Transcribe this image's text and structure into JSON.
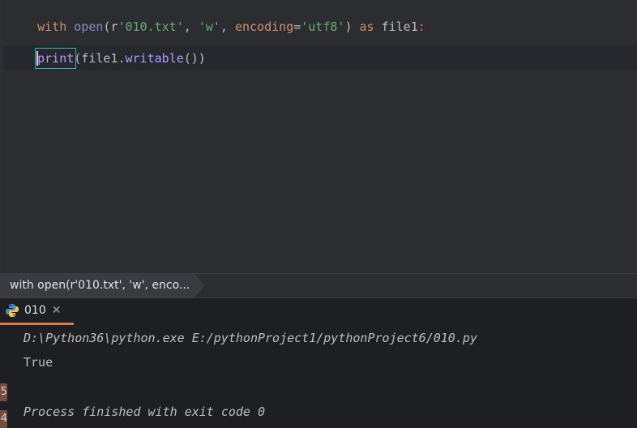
{
  "editor": {
    "line1": {
      "t1": "with",
      "t2": " ",
      "t3": "open",
      "t4": "(r",
      "t5": "'010.txt'",
      "t6": ", ",
      "t7": "'w'",
      "t8": ", ",
      "t9": "encoding",
      "t10": "=",
      "t11": "'utf8'",
      "t12": ") ",
      "t13": "as",
      "t14": " file1",
      "t15": ":"
    },
    "line3": {
      "indent": "    ",
      "t1": "print",
      "t2": "(file1.",
      "t3": "writable",
      "t4": "())"
    }
  },
  "breadcrumb": {
    "item": "with open(r'010.txt', 'w', enco..."
  },
  "run_panel": {
    "tab_label": "010",
    "close_glyph": "✕",
    "console": {
      "line1": "D:\\Python36\\python.exe E:/pythonProject1/pythonProject6/010.py",
      "line2": "True",
      "line3": "Process finished with exit code 0"
    },
    "gutter": [
      "5",
      "4"
    ]
  },
  "colors": {
    "editor_bg": "#2b2d30",
    "console_bg": "#1e1f22",
    "keyword": "#cf8e6d",
    "accent_tab": "#e0784f"
  }
}
